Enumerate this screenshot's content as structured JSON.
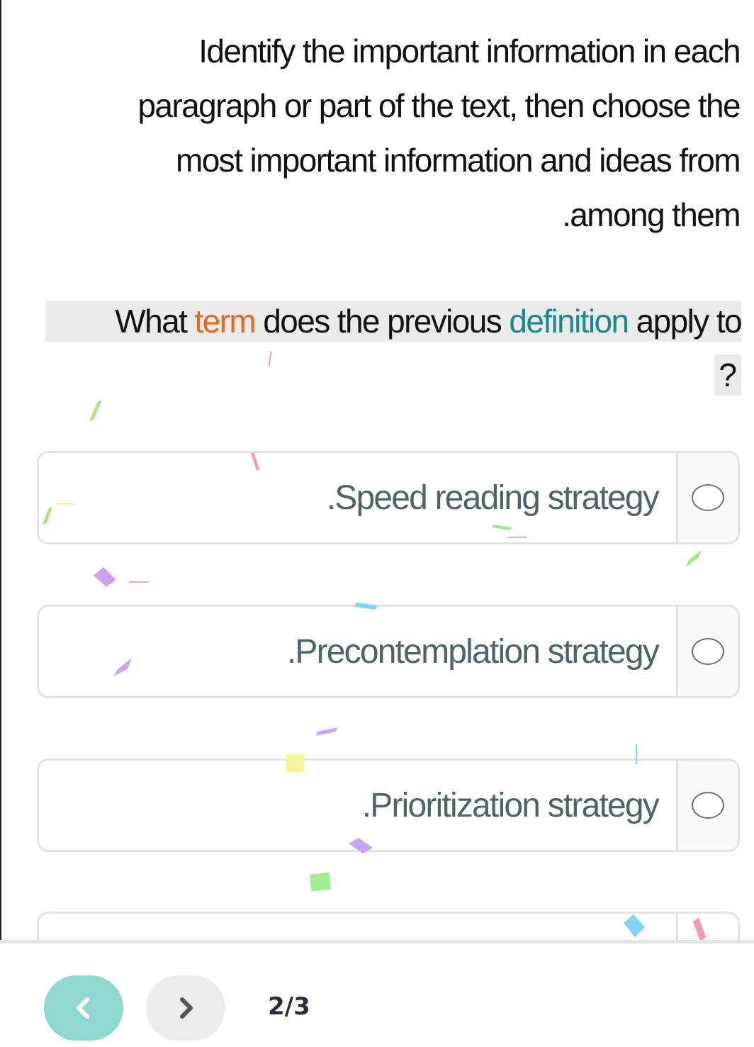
{
  "instructions": {
    "line1": "Identify the important information in each",
    "line2": "paragraph or part of the text, then choose the",
    "line3": "most important information and ideas from",
    "line4": ".among them"
  },
  "question": {
    "part1": "What ",
    "term": "term",
    "part2": " does the previous ",
    "definition": "definition",
    "part3": " apply to",
    "end": "?"
  },
  "options": [
    {
      "label": ".Speed reading strategy"
    },
    {
      "label": ".Precontemplation strategy"
    },
    {
      "label": ".Prioritization strategy"
    }
  ],
  "navigation": {
    "page_counter": "2/3",
    "prev_icon": "chevron-left-icon",
    "next_icon": "chevron-right-icon"
  },
  "colors": {
    "term_highlight": "#e8661f",
    "definition_highlight": "#1a8a87",
    "option_text": "#4e6368",
    "prev_button": "#8fd9cd",
    "next_button": "#ececec"
  }
}
